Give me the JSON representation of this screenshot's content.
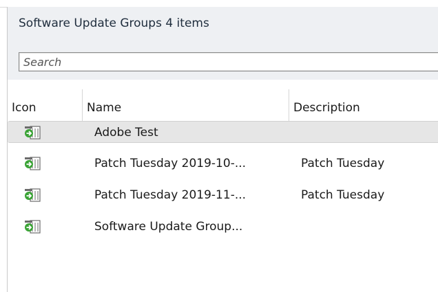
{
  "panel": {
    "title": "Software Update Groups 4 items"
  },
  "search": {
    "placeholder": "Search"
  },
  "table": {
    "columns": [
      {
        "label": "Icon"
      },
      {
        "label": "Name"
      },
      {
        "label": "Description"
      }
    ],
    "rows": [
      {
        "icon": "software-update-group-icon",
        "name": "Adobe Test",
        "description": "",
        "selected": true
      },
      {
        "icon": "software-update-group-icon",
        "name": "Patch Tuesday 2019-10-...",
        "description": "Patch Tuesday",
        "selected": false
      },
      {
        "icon": "software-update-group-icon",
        "name": "Patch Tuesday 2019-11-...",
        "description": "Patch Tuesday",
        "selected": false
      },
      {
        "icon": "software-update-group-icon",
        "name": "Software Update Group...",
        "description": "",
        "selected": false
      }
    ]
  },
  "colors": {
    "header_band": "#eef0f3",
    "selected_row": "#e6e6e6",
    "icon_green": "#3aa335",
    "icon_gray": "#6b6b6b"
  }
}
